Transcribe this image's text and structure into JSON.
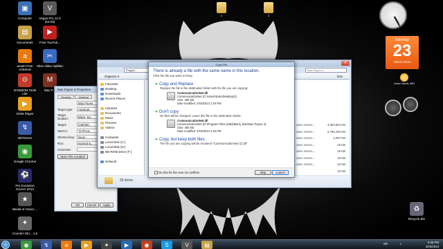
{
  "desktop_icons": [
    {
      "name": "Computer",
      "color": "#3b6fb3",
      "glyph": "▣"
    },
    {
      "name": "Documents",
      "color": "#c8a24a",
      "glyph": "▤"
    },
    {
      "name": "avast! Free Antivirus",
      "color": "#e87a10",
      "glyph": "a"
    },
    {
      "name": "DAEMON Tools Lite",
      "color": "#c23a2a",
      "glyph": "⊙"
    },
    {
      "name": "GOM Player",
      "color": "#e8a020",
      "glyph": "▶"
    },
    {
      "name": "BitTorrent",
      "color": "#3a5aa8",
      "glyph": "↯"
    },
    {
      "name": "Google Chrome",
      "color": "#3a9a3a",
      "glyph": "◉"
    },
    {
      "name": "Pro Evolution Soccer 2013",
      "color": "#2a2a6a",
      "glyph": "⚽"
    },
    {
      "name": "Medal of Honor ...",
      "color": "#555555",
      "glyph": "★"
    },
    {
      "name": "Counter-Stri... 1.6",
      "color": "#666666",
      "glyph": "✦"
    }
  ],
  "desktop_icons_col2": [
    {
      "name": "Vegas Pro 12.0 (64-bit)",
      "color": "#5a5a5a",
      "glyph": "V"
    },
    {
      "name": "Free YouTub...",
      "color": "#c02020",
      "glyph": "▶"
    },
    {
      "name": "Ultra Video Splitter",
      "color": "#3a6ac0",
      "glyph": "✂"
    },
    {
      "name": "Max P...",
      "color": "#803020",
      "glyph": "M"
    }
  ],
  "top_folders": [
    {
      "label": "1"
    },
    {
      "label": "2"
    }
  ],
  "recycle_bin": "Recycle Bin",
  "gadgets": {
    "calendar_dow": "Saturday",
    "calendar_day": "23",
    "calendar_month": "March 2013",
    "weather_city": "Kotor Varoš, BiH"
  },
  "props_window": {
    "title": "Max Payne 3 Properties",
    "tabs": [
      "Security",
      "General"
    ],
    "rows": [
      {
        "label": "",
        "value": "Max Payne"
      },
      {
        "label": "Target type:",
        "value": "Applicati..."
      },
      {
        "label": "Target location:",
        "value": "Black_Bo..."
      },
      {
        "label": "Target:",
        "value": "(x86)\\Bl..."
      },
      {
        "label": "Start in:",
        "value": "\"D:\\Prog..."
      },
      {
        "label": "Shortcut key:",
        "value": "None"
      },
      {
        "label": "Run:",
        "value": "Normal w..."
      },
      {
        "label": "Comment:",
        "value": ""
      }
    ],
    "open_location": "Open File Location",
    "ok": "OK",
    "cancel": "Cancel",
    "apply": "Apply"
  },
  "explorer": {
    "title": "Progra...",
    "organize": "Organize ▾",
    "address": "Progra...",
    "search": "Max Payne 3",
    "size_header": "Size",
    "nav": [
      {
        "label": "Favorites",
        "kind": "star"
      },
      {
        "label": "Desktop",
        "kind": "b"
      },
      {
        "label": "Downloads",
        "kind": "b"
      },
      {
        "label": "Recent Places",
        "kind": "b"
      },
      {
        "label": "",
        "kind": "none"
      },
      {
        "label": "Libraries",
        "kind": "y"
      },
      {
        "label": "Documents",
        "kind": "y"
      },
      {
        "label": "Music",
        "kind": "y"
      },
      {
        "label": "Pictures",
        "kind": "y"
      },
      {
        "label": "Videos",
        "kind": "y"
      },
      {
        "label": "",
        "kind": "none"
      },
      {
        "label": "Computer",
        "kind": "g"
      },
      {
        "label": "Local Disk (C:)",
        "kind": "g"
      },
      {
        "label": "Local Disk (D:)",
        "kind": "g"
      },
      {
        "label": "BD-ROM Drive (F:)",
        "kind": "g"
      },
      {
        "label": "",
        "kind": "none"
      },
      {
        "label": "Network",
        "kind": "b"
      }
    ],
    "types": [
      "...ation extens...",
      "...ation extens...",
      "...ation extens...",
      "...ation extens...",
      "...ation extens...",
      "...ation extens...",
      "...ation extens..."
    ],
    "sizes": [
      "3,383,904 KB",
      "2,785,152 KB",
      "1,097 KB",
      "16 KB",
      "16 KB",
      "16 KB",
      "16 KB",
      "16 KB"
    ],
    "status": "30 items"
  },
  "copy_dialog": {
    "title": "Copy File",
    "heading": "There is already a file with the same name in this location.",
    "sub": "Click the file you want to keep",
    "opt1_title": "Copy and Replace",
    "opt1_desc": "Replace the file in the destination folder with the file you are copying:",
    "opt1_file": "CommunicationNet.dll",
    "opt1_path": "CommunicationNet (C:\\Users\\Kare\\Desktop\\2)",
    "opt1_size": "Size: 400 KB",
    "opt1_date": "Date modified: 3/23/2013 1:34 PM",
    "opt2_title": "Don't copy",
    "opt2_desc": "No files will be changed. Leave this file in the destination folder:",
    "opt2_file": "CommunicationNet.dll",
    "opt2_path": "CommunicationNet (D:\\Program Files (x86)\\Black_Box\\Max Payne 3)",
    "opt2_size": "Size: 400 KB",
    "opt2_date": "Date modified: 3/23/2013 1:34 PM",
    "opt3_title": "Copy, but keep both files",
    "opt3_desc": "The file you are copying will be renamed \"CommunicationNet (2).dll\"",
    "do_this": "Do this for the next 10 conflicts",
    "skip": "Skip",
    "cancel": "Cancel"
  },
  "taskbar": {
    "apps": [
      {
        "name": "chrome",
        "glyph": "◉",
        "color": "#3a9a3a"
      },
      {
        "name": "bittorrent",
        "glyph": "↯",
        "color": "#3a5aa8"
      },
      {
        "name": "avast",
        "glyph": "a",
        "color": "#e87a10"
      },
      {
        "name": "gom",
        "glyph": "▶",
        "color": "#e8a020"
      },
      {
        "name": "game",
        "glyph": "✦",
        "color": "#444444"
      },
      {
        "name": "media",
        "glyph": "▶",
        "color": "#2a6ab0"
      },
      {
        "name": "chrome2",
        "glyph": "◉",
        "color": "#c04020"
      },
      {
        "name": "skype",
        "glyph": "S",
        "color": "#1a9ae0"
      },
      {
        "name": "vegas",
        "glyph": "V",
        "color": "#555555"
      },
      {
        "name": "explorer",
        "glyph": "▤",
        "color": "#c8a24a"
      }
    ],
    "lang": "SR",
    "time": "5:25 PM",
    "date": "3/23/2013"
  }
}
